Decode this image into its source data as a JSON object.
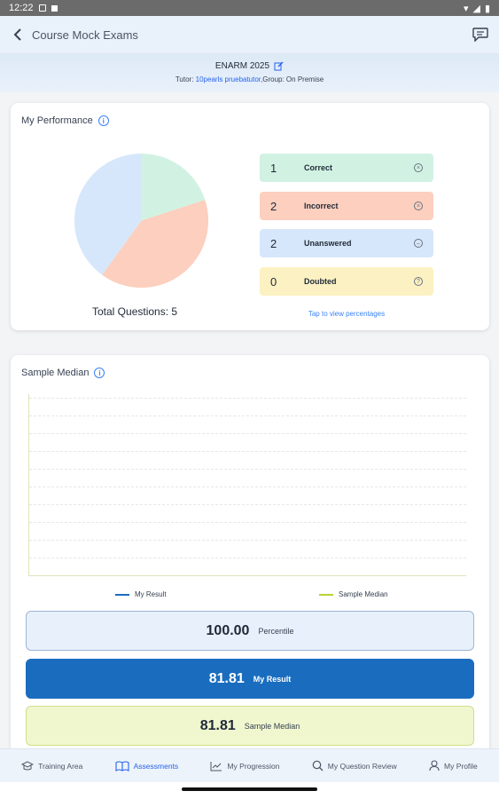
{
  "status": {
    "time": "12:22"
  },
  "app_bar": {
    "title": "Course Mock Exams"
  },
  "banner": {
    "exam_name": "ENARM 2025",
    "tutor_prefix": "Tutor: ",
    "tutor_name": "10pearls pruebatutor",
    "group_text": ",Group: On Premise"
  },
  "performance": {
    "title": "My Performance",
    "total_label": "Total Questions:",
    "total_value": "5",
    "tap_hint": "Tap to view percentages",
    "stats": [
      {
        "count": "1",
        "label": "Correct",
        "icon": "x-circle-icon",
        "color": "#d1f2e3"
      },
      {
        "count": "2",
        "label": "Incorrect",
        "icon": "x-circle-icon",
        "color": "#fccfbe"
      },
      {
        "count": "2",
        "label": "Unanswered",
        "icon": "minus-circle-icon",
        "color": "#d7e7fb"
      },
      {
        "count": "0",
        "label": "Doubted",
        "icon": "question-circle-icon",
        "color": "#fcf1c2"
      }
    ],
    "pie_colors": {
      "correct": "#d1f2e3",
      "incorrect": "#fccfbe",
      "unanswered": "#d7e7fb"
    }
  },
  "median": {
    "title": "Sample Median",
    "legend_my_result": "My Result",
    "legend_sample_median": "Sample Median",
    "legend_colors": {
      "my_result": "#1a6dbe",
      "sample_median": "#b7d235"
    },
    "percentile_value": "100.00",
    "percentile_label": "Percentile",
    "my_result_value": "81.81",
    "my_result_label": "My Result",
    "median_value": "81.81",
    "median_label": "Sample Median"
  },
  "nav": {
    "items": [
      {
        "label": "Training Area",
        "icon": "graduation-cap-icon"
      },
      {
        "label": "Assessments",
        "icon": "book-icon"
      },
      {
        "label": "My Progression",
        "icon": "chart-line-icon"
      },
      {
        "label": "My Question Review",
        "icon": "search-icon"
      },
      {
        "label": "My Profile",
        "icon": "user-icon"
      }
    ],
    "active_index": 1
  }
}
